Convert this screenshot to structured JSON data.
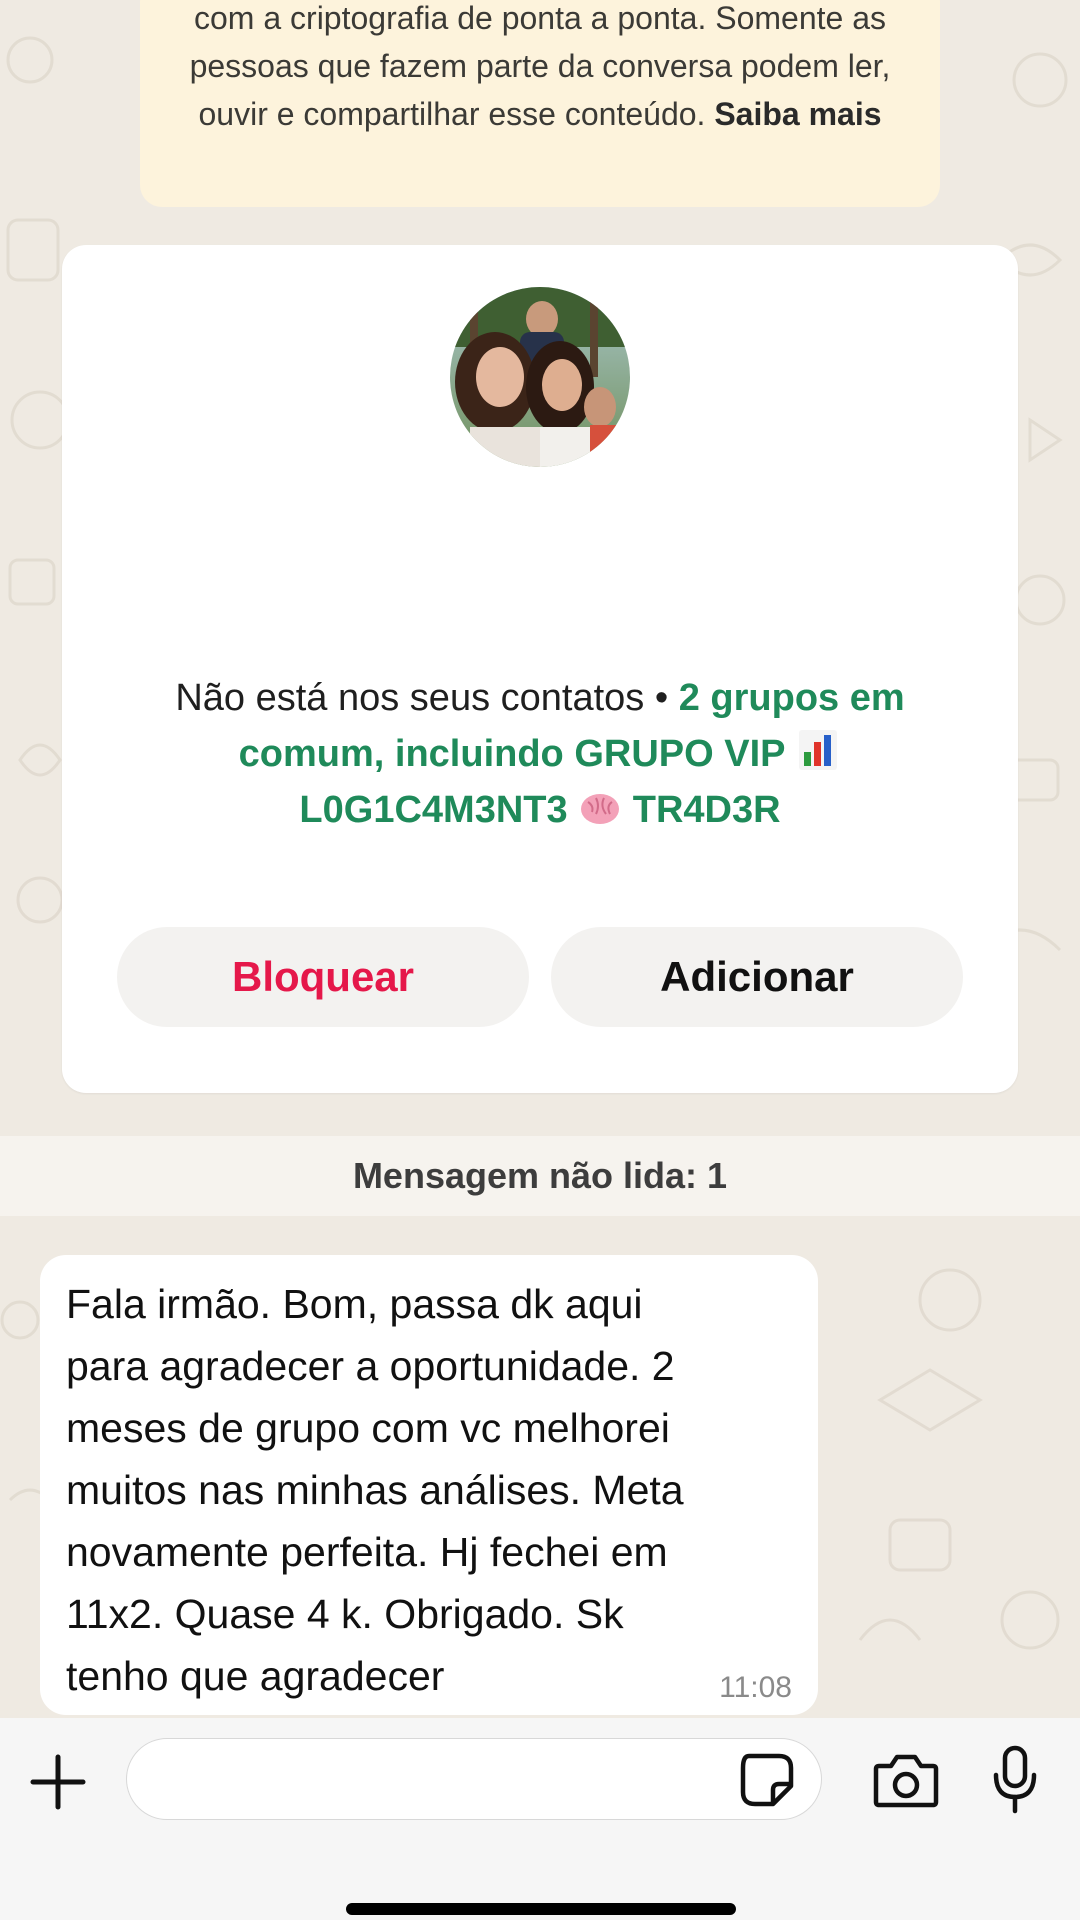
{
  "encryption_notice": {
    "text": "com a criptografia de ponta a ponta. Somente as pessoas que fazem parte da conversa podem ler, ouvir e compartilhar esse conteúdo.",
    "link": "Saiba mais"
  },
  "contact_card": {
    "not_in_contacts": "Não está nos seus contatos",
    "separator": "•",
    "groups_text": "2 grupos em comum, incluindo GRUPO VIP",
    "group_name": "L0G1C4M3NT3",
    "group_name_suffix": "TR4D3R",
    "avatar_icon": "profile-photo",
    "block_label": "Bloquear",
    "add_label": "Adicionar"
  },
  "unread_divider": "Mensagem não lida: 1",
  "message": {
    "text": "Fala irmão. Bom, passa dk aqui\npara agradecer a oportunidade. 2\nmeses de grupo com vc melhorei\nmuitos nas minhas análises. Meta\nnovamente perfeita. Hj fechei em\n11x2.  Quase 4 k. Obrigado. Sk\ntenho que agradecer",
    "time": "11:08"
  },
  "composer": {
    "placeholder": "",
    "icons": [
      "plus-icon",
      "sticker-icon",
      "camera-icon",
      "microphone-icon"
    ]
  },
  "colors": {
    "accent_green": "#1f8a5a",
    "block_red": "#e5184a",
    "notice_bg": "#fdf3dc",
    "chat_bg": "#efeae2"
  }
}
